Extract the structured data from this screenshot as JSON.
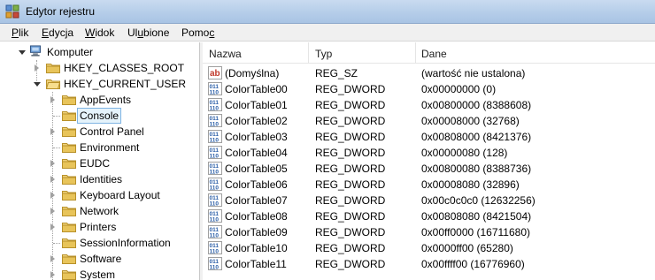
{
  "window": {
    "title": "Edytor rejestru",
    "icon": "registry-editor-icon"
  },
  "menu": [
    {
      "pre": "",
      "acc": "P",
      "post": "lik"
    },
    {
      "pre": "",
      "acc": "E",
      "post": "dycja"
    },
    {
      "pre": "",
      "acc": "W",
      "post": "idok"
    },
    {
      "pre": "Ul",
      "acc": "u",
      "post": "bione"
    },
    {
      "pre": "Pomo",
      "acc": "c",
      "post": ""
    }
  ],
  "tree": {
    "root": {
      "label": "Komputer",
      "icon": "computer-icon"
    },
    "hives": [
      {
        "label": "HKEY_CLASSES_ROOT"
      },
      {
        "label": "HKEY_CURRENT_USER"
      }
    ],
    "children": [
      {
        "label": "AppEvents"
      },
      {
        "label": "Console"
      },
      {
        "label": "Control Panel"
      },
      {
        "label": "Environment"
      },
      {
        "label": "EUDC"
      },
      {
        "label": "Identities"
      },
      {
        "label": "Keyboard Layout"
      },
      {
        "label": "Network"
      },
      {
        "label": "Printers"
      },
      {
        "label": "SessionInformation"
      },
      {
        "label": "Software"
      },
      {
        "label": "System"
      }
    ]
  },
  "list": {
    "columns": [
      "Nazwa",
      "Typ",
      "Dane"
    ],
    "rows": [
      {
        "icon": "string-value-icon",
        "name": "(Domyślna)",
        "type": "REG_SZ",
        "data": "(wartość nie ustalona)"
      },
      {
        "icon": "binary-value-icon",
        "name": "ColorTable00",
        "type": "REG_DWORD",
        "data": "0x00000000 (0)"
      },
      {
        "icon": "binary-value-icon",
        "name": "ColorTable01",
        "type": "REG_DWORD",
        "data": "0x00800000 (8388608)"
      },
      {
        "icon": "binary-value-icon",
        "name": "ColorTable02",
        "type": "REG_DWORD",
        "data": "0x00008000 (32768)"
      },
      {
        "icon": "binary-value-icon",
        "name": "ColorTable03",
        "type": "REG_DWORD",
        "data": "0x00808000 (8421376)"
      },
      {
        "icon": "binary-value-icon",
        "name": "ColorTable04",
        "type": "REG_DWORD",
        "data": "0x00000080 (128)"
      },
      {
        "icon": "binary-value-icon",
        "name": "ColorTable05",
        "type": "REG_DWORD",
        "data": "0x00800080 (8388736)"
      },
      {
        "icon": "binary-value-icon",
        "name": "ColorTable06",
        "type": "REG_DWORD",
        "data": "0x00008080 (32896)"
      },
      {
        "icon": "binary-value-icon",
        "name": "ColorTable07",
        "type": "REG_DWORD",
        "data": "0x00c0c0c0 (12632256)"
      },
      {
        "icon": "binary-value-icon",
        "name": "ColorTable08",
        "type": "REG_DWORD",
        "data": "0x00808080 (8421504)"
      },
      {
        "icon": "binary-value-icon",
        "name": "ColorTable09",
        "type": "REG_DWORD",
        "data": "0x00ff0000 (16711680)"
      },
      {
        "icon": "binary-value-icon",
        "name": "ColorTable10",
        "type": "REG_DWORD",
        "data": "0x0000ff00 (65280)"
      },
      {
        "icon": "binary-value-icon",
        "name": "ColorTable11",
        "type": "REG_DWORD",
        "data": "0x00ffff00 (16776960)"
      }
    ]
  },
  "colors": {
    "selection_bg": "#e5f3fb",
    "selection_border": "#7fb4e3",
    "folder": "#e8c45a",
    "sz_icon": "#c0392b",
    "dword_icon": "#2b5fa8"
  }
}
